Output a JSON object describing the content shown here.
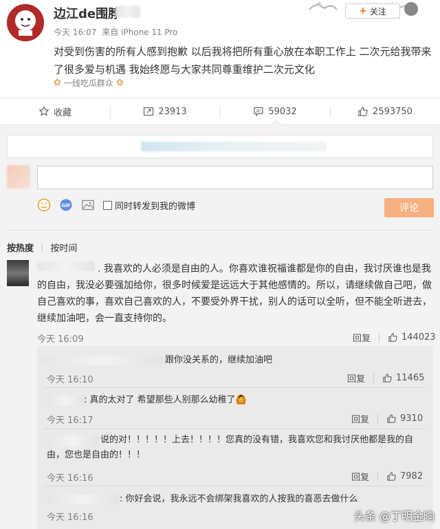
{
  "post": {
    "username": "边江de围脖",
    "time": "今天 16:07",
    "source": "来自 iPhone 11 Pro",
    "text": "对受到伤害的所有人感到抱歉 以后我将把所有重心放在本职工作上  二次元给我带来了很多爱与机遇 我始终愿与大家共同尊重维护二次元文化",
    "tag": "一线吃瓜群众",
    "follow_label": "关注"
  },
  "actions": {
    "favorite": "收藏",
    "repost_count": "23913",
    "comment_count": "59032",
    "like_count": "2593750"
  },
  "composer": {
    "repost_label": "同时转发到我的微博",
    "submit_label": "评论"
  },
  "sort": {
    "hot": "按热度",
    "time": "按时间"
  },
  "top_comment": {
    "text": ". 我喜欢的人必须是自由的人。你喜欢谁祝福谁都是你的自由，我讨厌谁也是我的自由，我没必要强加给你，很多时候爱是远远大于其他感情的。所以，请继续做自己吧，做自己喜欢的事，喜欢自己喜欢的人，不要受外界干扰，别人的话可以全听，但不能全听进去，继续加油吧，会一直支持你的。",
    "time": "今天 16:09",
    "reply_label": "回复",
    "likes": "144023"
  },
  "replies": [
    {
      "text": "跟你没关系的，继续加油吧",
      "time": "今天 16:10",
      "reply_label": "回复",
      "likes": "11465"
    },
    {
      "text": ": 真的太对了 希望那些人别那么幼稚了🙆",
      "time": "今天 16:17",
      "reply_label": "回复",
      "likes": "9310"
    },
    {
      "text": "说的对！！！！！上去！！！！您真的没有错，我喜欢您和我讨厌他都是我的自由，您也是自由的！！！",
      "time": "今天 16:16",
      "reply_label": "回复",
      "likes": "7982"
    },
    {
      "text": ": 你好会说，我永远不会绑架我喜欢的人按我的喜恶去做什么",
      "time": "今天 16:16"
    }
  ],
  "watermark": "头条 @丁明金晌",
  "colors": {
    "accent": "#f56b1c",
    "submit_bg": "#f7b07f",
    "panel_bg": "#f3f3f3",
    "reply_bg": "#eaeaea"
  }
}
